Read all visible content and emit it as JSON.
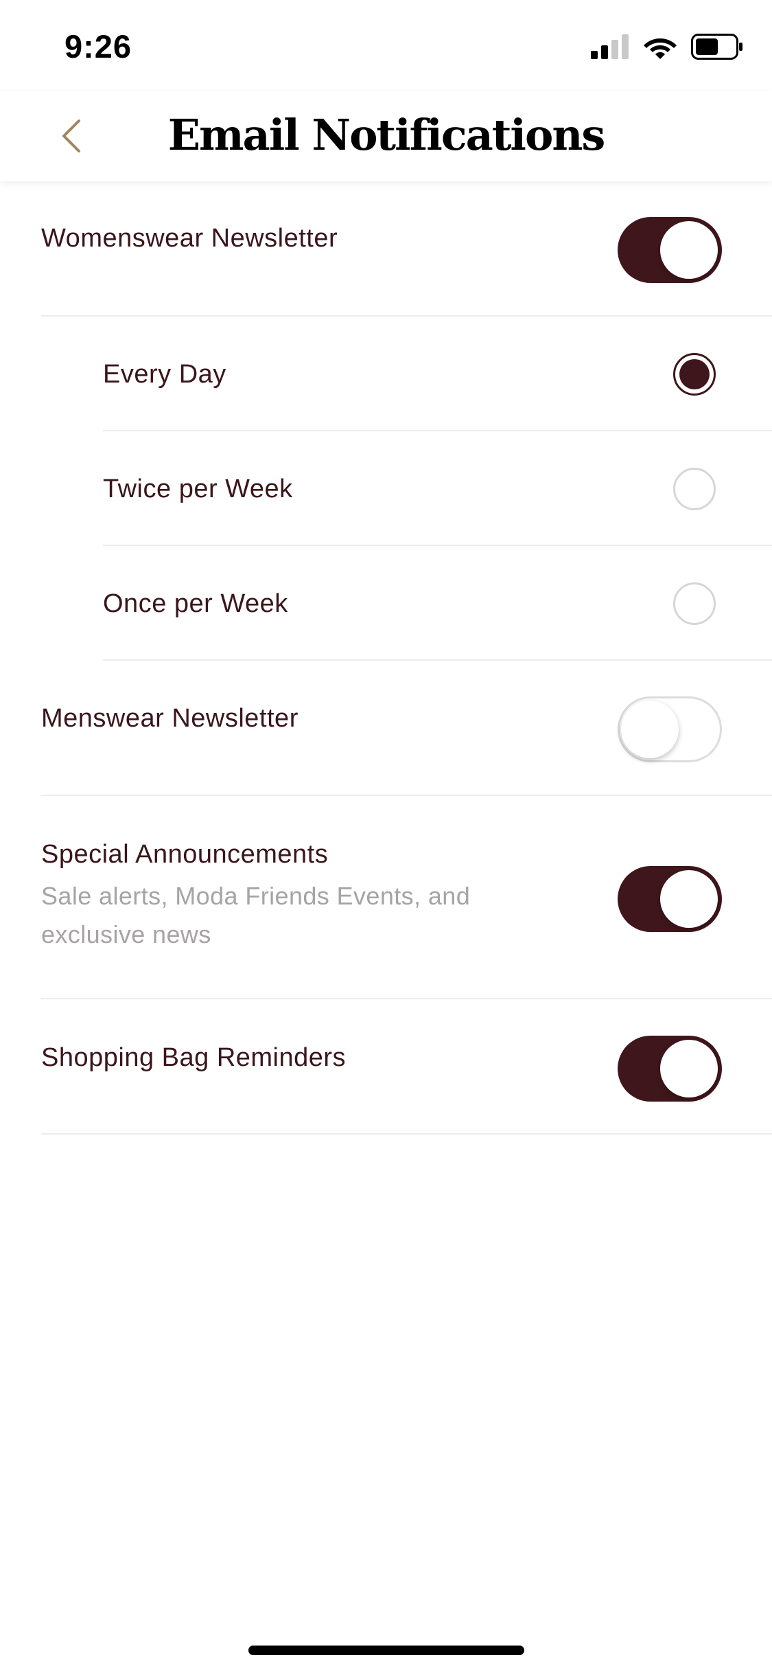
{
  "status_bar": {
    "time": "9:26",
    "signal_icon": "cellular-signal-icon",
    "wifi_icon": "wifi-icon",
    "battery_icon": "battery-icon"
  },
  "nav": {
    "back_icon": "chevron-left-icon",
    "title": "Email Notifications"
  },
  "colors": {
    "accent": "#3f161b",
    "back_chevron": "#a08560",
    "text_primary": "#3a161b",
    "text_secondary": "#a7a3a4",
    "divider": "#ededed"
  },
  "settings": {
    "womenswear": {
      "label": "Womenswear Newsletter",
      "enabled": true,
      "frequency_options": [
        {
          "label": "Every Day",
          "selected": true
        },
        {
          "label": "Twice per Week",
          "selected": false
        },
        {
          "label": "Once per Week",
          "selected": false
        }
      ]
    },
    "menswear": {
      "label": "Menswear Newsletter",
      "enabled": false
    },
    "special_announcements": {
      "label": "Special Announcements",
      "description": "Sale alerts, Moda Friends Events, and exclusive news",
      "enabled": true
    },
    "shopping_bag_reminders": {
      "label": "Shopping Bag Reminders",
      "enabled": true
    }
  }
}
